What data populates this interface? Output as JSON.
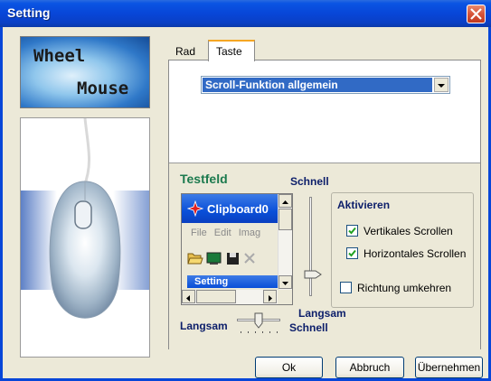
{
  "window": {
    "title": "Setting"
  },
  "logo": {
    "line1": "Wheel",
    "line2": "Mouse"
  },
  "tabs": [
    {
      "label": "Rad",
      "active": false
    },
    {
      "label": "Taste",
      "active": true
    }
  ],
  "dropdown": {
    "value": "Scroll-Funktion allgemein"
  },
  "testfeld": {
    "label": "Testfeld",
    "window_title": "Clipboard0",
    "menu": [
      "File",
      "Edit",
      "Imag"
    ],
    "inner_title": "Setting"
  },
  "vertical_slider": {
    "top_label": "Schnell",
    "bottom_label": "Langsam",
    "level": 0.3
  },
  "horizontal_slider": {
    "left_label": "Langsam",
    "right_label": "Schnell",
    "level": 0.45
  },
  "activate_group": {
    "title": "Aktivieren",
    "vertical_scroll": {
      "label": "Vertikales Scrollen",
      "checked": true
    },
    "horizontal_scroll": {
      "label": "Horizontales Scrollen",
      "checked": true
    }
  },
  "reverse": {
    "label": "Richtung umkehren",
    "checked": false
  },
  "buttons": {
    "ok": "Ok",
    "cancel": "Abbruch",
    "apply": "Übernehmen"
  },
  "colors": {
    "titlebar": "#0846d8",
    "selection": "#316ac5",
    "testfeld_label": "#1c7a4e",
    "group_label": "#0c1e6a"
  }
}
